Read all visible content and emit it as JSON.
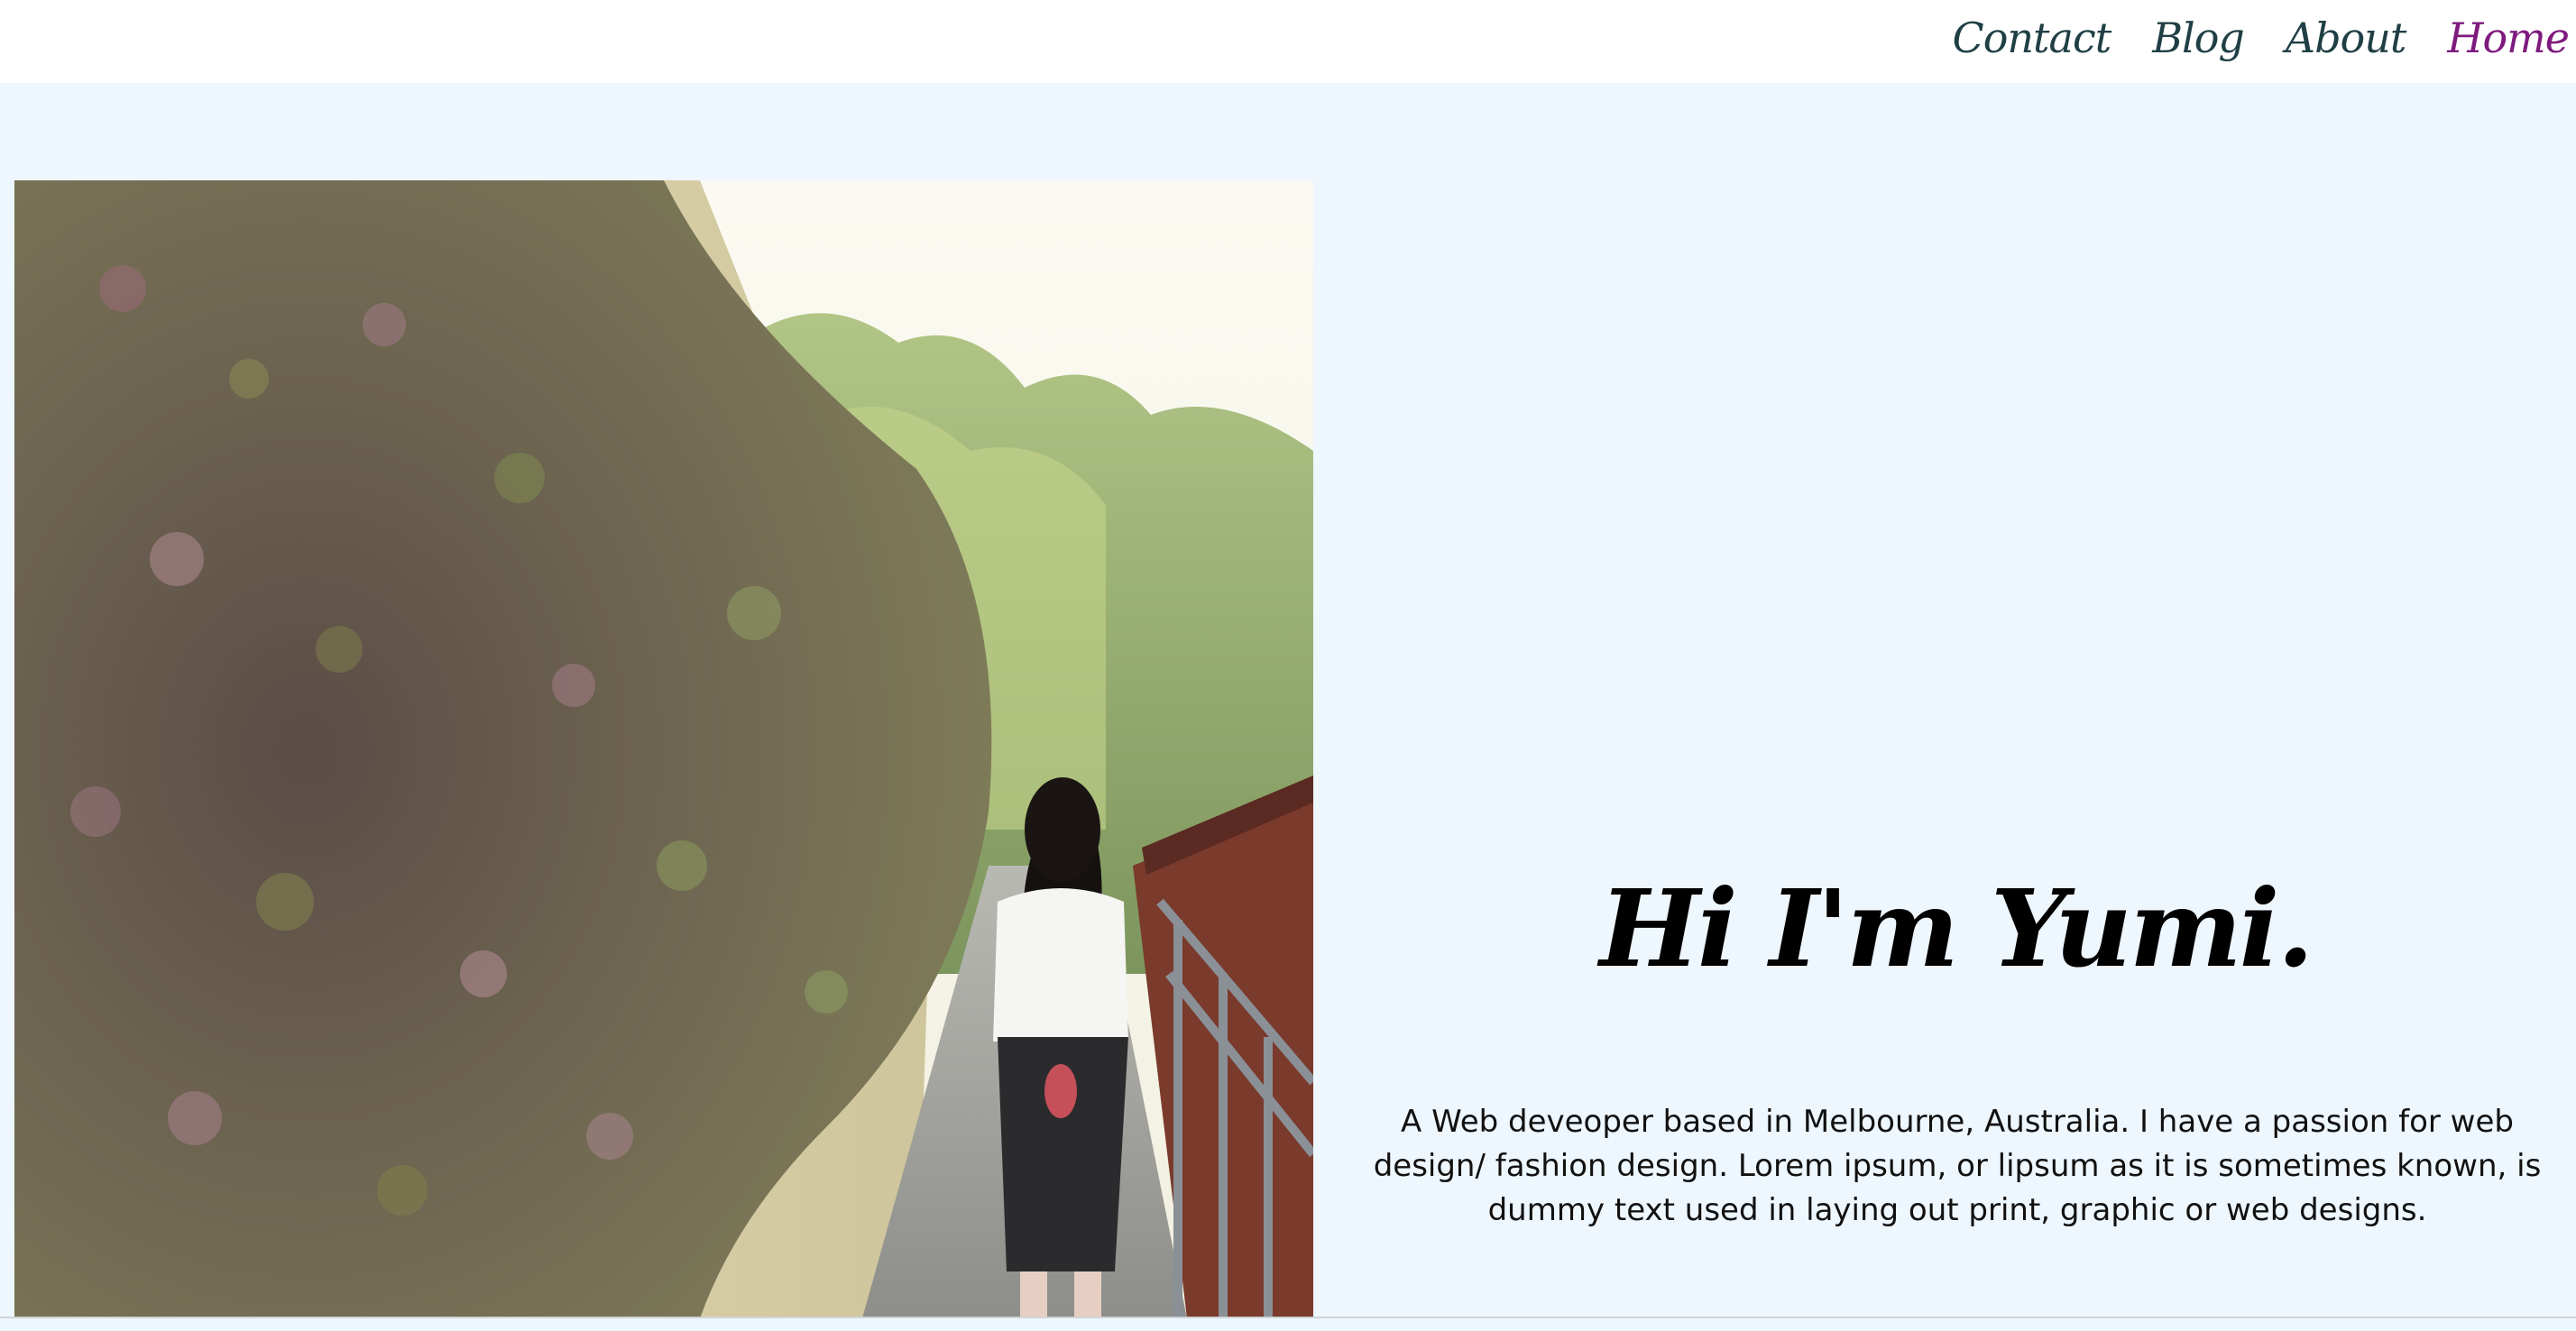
{
  "nav": {
    "items": [
      {
        "label": "Home",
        "active": true
      },
      {
        "label": "About",
        "active": false
      },
      {
        "label": "Blog",
        "active": false
      },
      {
        "label": "Contact",
        "active": false
      }
    ]
  },
  "hero": {
    "title": "Hi I'm Yumi.",
    "description": "A Web deveoper based in Melbourne, Australia. I have a passion for web design/ fashion design. Lorem ipsum, or lipsum as it is sometimes known, is dummy text used in laying out print, graphic or web designs."
  },
  "colors": {
    "page_background": "#eef6fe",
    "nav_background": "#ffffff",
    "nav_text": "#1f3f45",
    "nav_active": "#7e1a7e",
    "title_text": "#000000"
  },
  "icons": {
    "photo": "person-walking-beside-ivy-wall-photo"
  }
}
